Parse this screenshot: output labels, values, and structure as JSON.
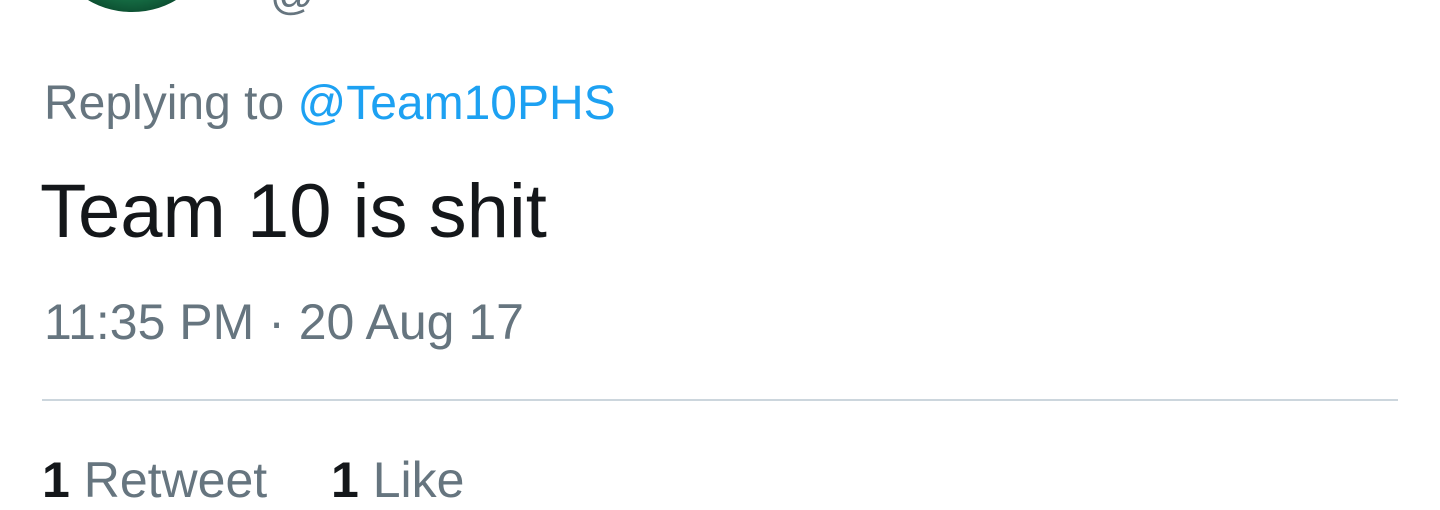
{
  "author": {
    "handle_partial": "@"
  },
  "reply": {
    "prefix": "Replying to ",
    "mention": "@Team10PHS"
  },
  "tweet": {
    "text": "Team 10 is shit",
    "timestamp": "11:35 PM · 20 Aug 17"
  },
  "stats": {
    "retweets": {
      "count": "1",
      "label": "Retweet"
    },
    "likes": {
      "count": "1",
      "label": "Like"
    }
  },
  "colors": {
    "text": "#14171a",
    "muted": "#66757f",
    "link": "#1da1f2",
    "divider": "#ccd6dd"
  }
}
